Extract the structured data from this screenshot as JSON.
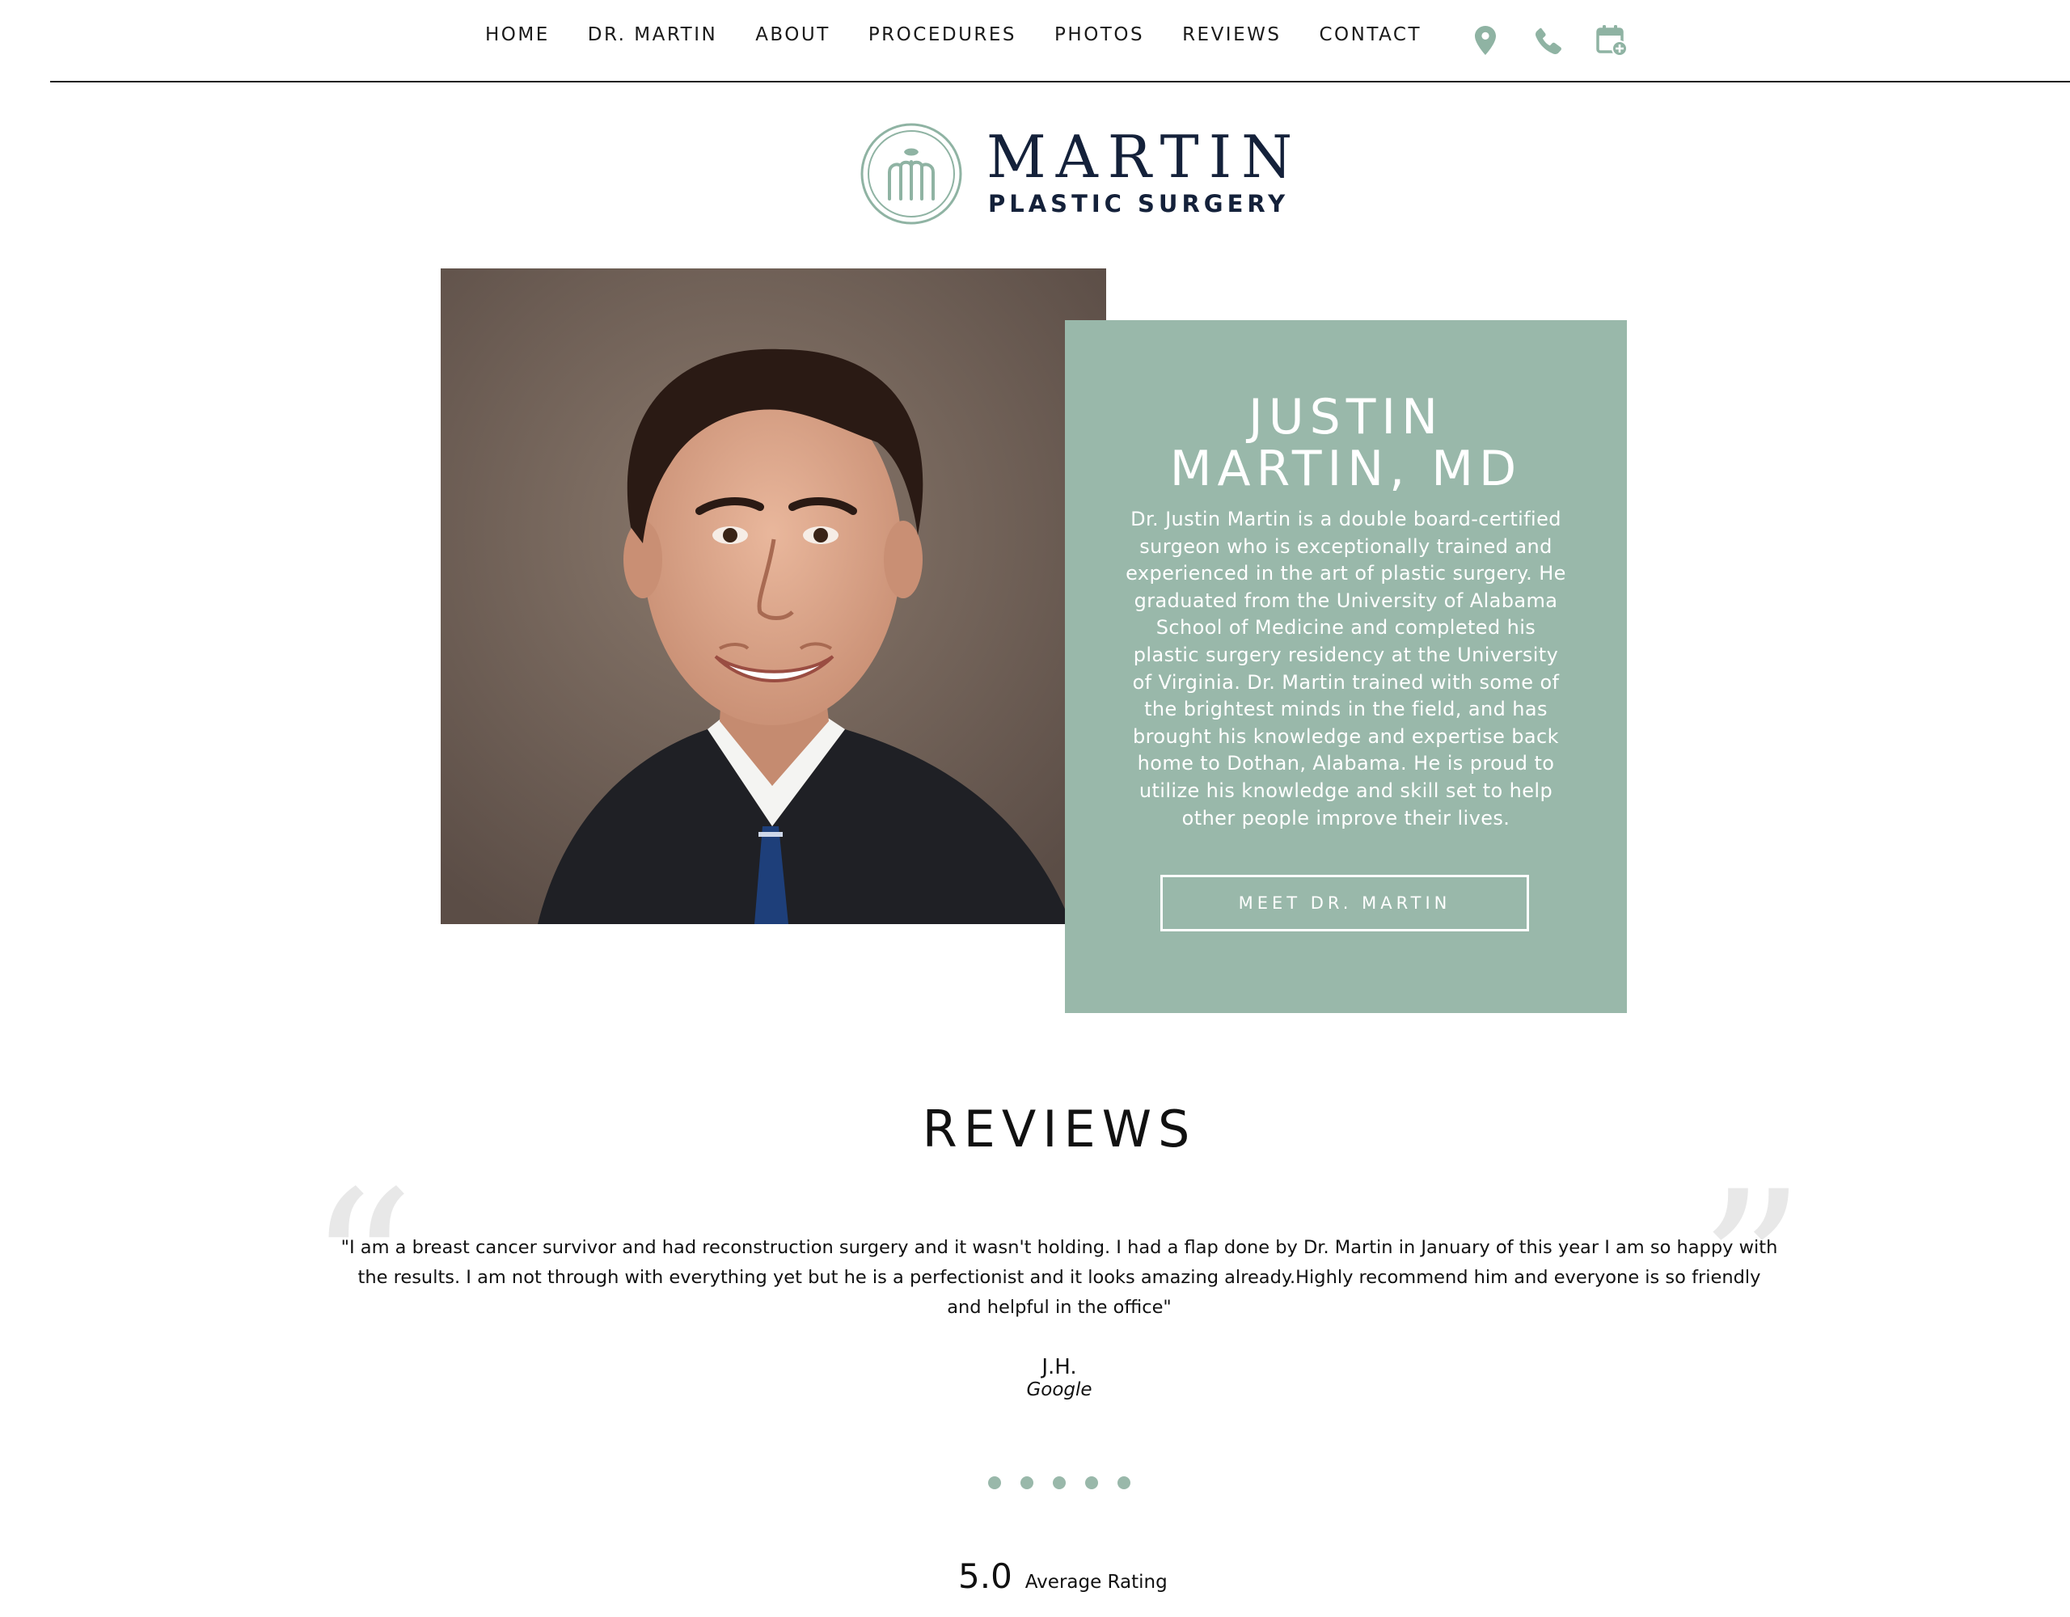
{
  "nav": {
    "links": [
      "HOME",
      "DR. MARTIN",
      "ABOUT",
      "PROCEDURES",
      "PHOTOS",
      "REVIEWS",
      "CONTACT"
    ],
    "icons": [
      "location-pin-icon",
      "phone-icon",
      "calendar-add-icon"
    ],
    "icon_color": "#8fb3a3"
  },
  "logo": {
    "name": "MARTIN",
    "subtitle": "PLASTIC SURGERY",
    "mark_color": "#8fb3a3",
    "text_color": "#14213a"
  },
  "hero": {
    "title": "JUSTIN\nMARTIN, MD",
    "bio": "Dr. Justin Martin is a double board-certified surgeon who is exceptionally trained and experienced in the art of plastic surgery. He graduated from the University of Alabama School of Medicine and completed his plastic surgery residency at the University of Virginia. Dr. Martin trained with some of the brightest minds in the field, and has brought his knowledge and expertise back home to Dothan, Alabama. He is proud to utilize his knowledge and skill set to help other people improve their lives.",
    "button_label": "MEET DR. MARTIN",
    "card_color": "#99b8aa"
  },
  "reviews": {
    "heading": "REVIEWS",
    "quote_open": "“",
    "quote_close": "”",
    "text": "\"I am a breast cancer survivor and had reconstruction surgery and it wasn't holding. I had a flap done by Dr. Martin in January of this year I am so happy with the results. I am not through with everything yet but he is a perfectionist and it looks amazing already.Highly recommend him and everyone is so friendly and helpful in the office\"",
    "reviewer": "J.H.",
    "source": "Google",
    "pagination_count": 5
  },
  "rating": {
    "score": "5.0",
    "label": "Average Rating"
  }
}
